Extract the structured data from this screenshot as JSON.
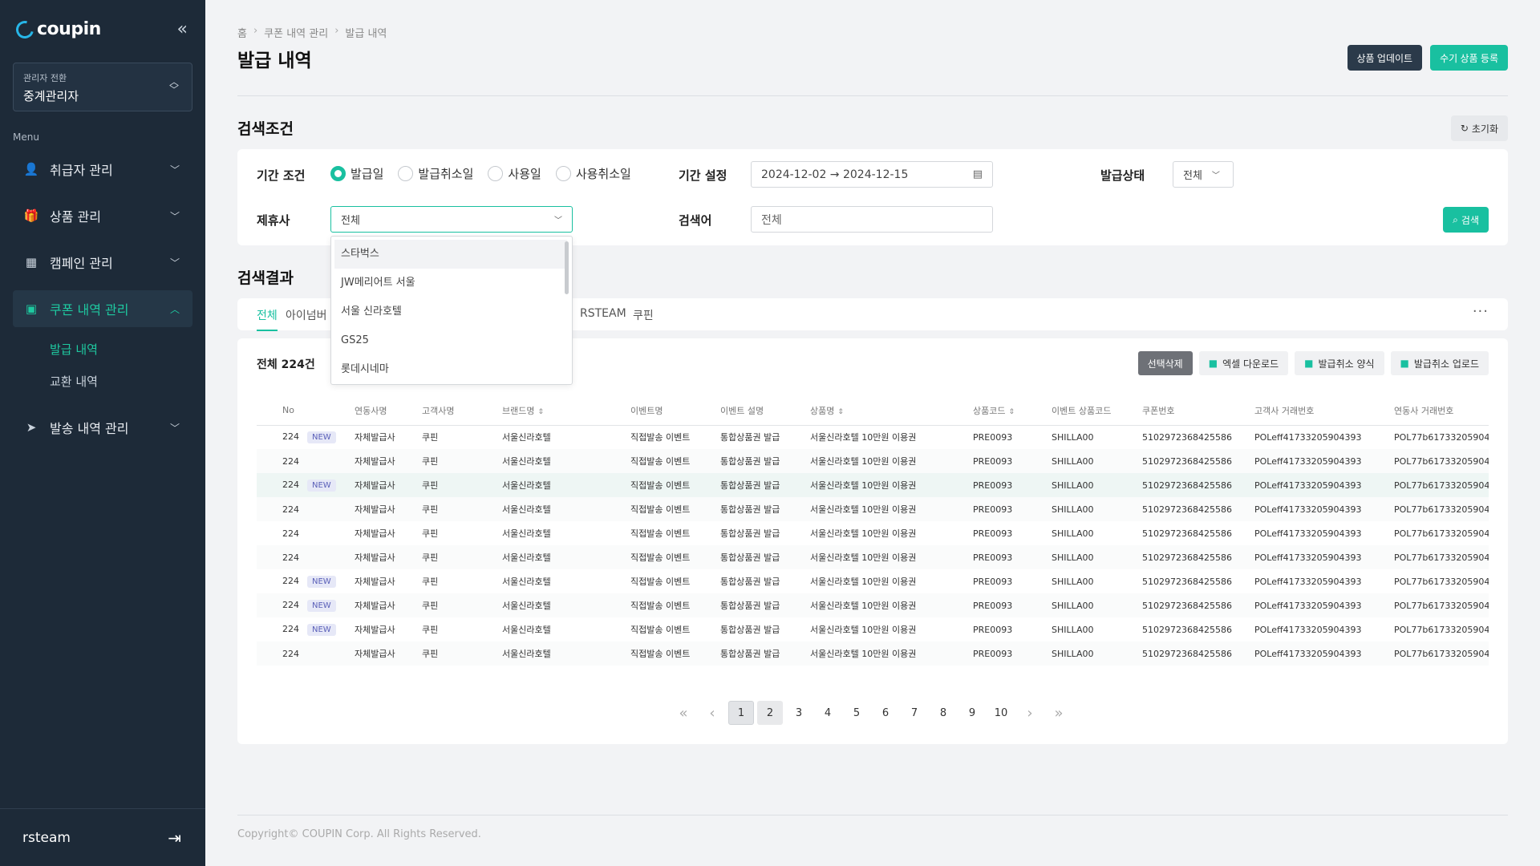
{
  "app": {
    "logo": "coupin",
    "collapse_icon": "«"
  },
  "sidebar": {
    "admin_switch_label": "관리자 전환",
    "admin_switch_value": "중계관리자",
    "menu_label": "Menu",
    "items": [
      {
        "label": "취급자 관리",
        "icon": "user-gear-icon"
      },
      {
        "label": "상품 관리",
        "icon": "gift-icon"
      },
      {
        "label": "캠페인 관리",
        "icon": "calendar-icon"
      },
      {
        "label": "쿠폰 내역 관리",
        "icon": "ticket-icon"
      },
      {
        "label": "발송 내역 관리",
        "icon": "send-icon"
      }
    ],
    "sub_items": [
      {
        "label": "발급 내역"
      },
      {
        "label": "교환 내역"
      }
    ],
    "footer_user": "rsteam"
  },
  "breadcrumb": [
    "홈",
    "쿠폰 내역 관리",
    "발급 내역"
  ],
  "page_title": "발급 내역",
  "top_buttons": {
    "update": "상품 업데이트",
    "manual": "수기 상품 등록"
  },
  "search": {
    "title": "검색조건",
    "reset": "초기화",
    "period_label": "기간 조건",
    "radios": [
      "발급일",
      "발급취소일",
      "사용일",
      "사용취소일"
    ],
    "period_setting_label": "기간 설정",
    "date_range": "2024-12-02 → 2024-12-15",
    "status_label": "발급상태",
    "status_value": "전체",
    "partner_label": "제휴사",
    "partner_value": "전체",
    "keyword_label": "검색어",
    "keyword_placeholder": "전체",
    "search_button": "검색"
  },
  "dropdown": [
    "스타벅스",
    "JW메리어트 서울",
    "서울 신라호텔",
    "GS25",
    "롯데시네마"
  ],
  "results": {
    "title": "검색결과",
    "tabs": [
      "전체",
      "아이넘버 인",
      "RSTEAM",
      "쿠핀"
    ],
    "total": "전체 224건",
    "actions": {
      "delete": "선택삭제",
      "excel": "엑셀 다운로드",
      "cancel_form": "발급취소 양식",
      "cancel_upload": "발급취소 업로드"
    },
    "columns": [
      "No",
      "연동사명",
      "고객사명",
      "브랜드명",
      "이벤트명",
      "이벤트 설명",
      "상품명",
      "상품코드",
      "이벤트 상품코드",
      "쿠폰번호",
      "고객사 거래번호",
      "연동사 거래번호"
    ],
    "new_label": "NEW",
    "rows": [
      {
        "no": "224",
        "new": true,
        "a": "자체발급사",
        "b": "쿠핀",
        "c": "서울신라호텔",
        "d": "직접발송 이벤트",
        "e": "통합상품권 발급",
        "f": "서울신라호텔 10만원 이용권",
        "g": "PRE0093",
        "h": "SHILLA00",
        "i": "5102972368425586",
        "j": "POLeff41733205904393",
        "k": "POL77b61733205904"
      },
      {
        "no": "224",
        "new": false,
        "a": "자체발급사",
        "b": "쿠핀",
        "c": "서울신라호텔",
        "d": "직접발송 이벤트",
        "e": "통합상품권 발급",
        "f": "서울신라호텔 10만원 이용권",
        "g": "PRE0093",
        "h": "SHILLA00",
        "i": "5102972368425586",
        "j": "POLeff41733205904393",
        "k": "POL77b61733205904"
      },
      {
        "no": "224",
        "new": true,
        "a": "자체발급사",
        "b": "쿠핀",
        "c": "서울신라호텔",
        "d": "직접발송 이벤트",
        "e": "통합상품권 발급",
        "f": "서울신라호텔 10만원 이용권",
        "g": "PRE0093",
        "h": "SHILLA00",
        "i": "5102972368425586",
        "j": "POLeff41733205904393",
        "k": "POL77b61733205904"
      },
      {
        "no": "224",
        "new": false,
        "a": "자체발급사",
        "b": "쿠핀",
        "c": "서울신라호텔",
        "d": "직접발송 이벤트",
        "e": "통합상품권 발급",
        "f": "서울신라호텔 10만원 이용권",
        "g": "PRE0093",
        "h": "SHILLA00",
        "i": "5102972368425586",
        "j": "POLeff41733205904393",
        "k": "POL77b61733205904"
      },
      {
        "no": "224",
        "new": false,
        "a": "자체발급사",
        "b": "쿠핀",
        "c": "서울신라호텔",
        "d": "직접발송 이벤트",
        "e": "통합상품권 발급",
        "f": "서울신라호텔 10만원 이용권",
        "g": "PRE0093",
        "h": "SHILLA00",
        "i": "5102972368425586",
        "j": "POLeff41733205904393",
        "k": "POL77b61733205904"
      },
      {
        "no": "224",
        "new": false,
        "a": "자체발급사",
        "b": "쿠핀",
        "c": "서울신라호텔",
        "d": "직접발송 이벤트",
        "e": "통합상품권 발급",
        "f": "서울신라호텔 10만원 이용권",
        "g": "PRE0093",
        "h": "SHILLA00",
        "i": "5102972368425586",
        "j": "POLeff41733205904393",
        "k": "POL77b61733205904"
      },
      {
        "no": "224",
        "new": true,
        "a": "자체발급사",
        "b": "쿠핀",
        "c": "서울신라호텔",
        "d": "직접발송 이벤트",
        "e": "통합상품권 발급",
        "f": "서울신라호텔 10만원 이용권",
        "g": "PRE0093",
        "h": "SHILLA00",
        "i": "5102972368425586",
        "j": "POLeff41733205904393",
        "k": "POL77b61733205904"
      },
      {
        "no": "224",
        "new": true,
        "a": "자체발급사",
        "b": "쿠핀",
        "c": "서울신라호텔",
        "d": "직접발송 이벤트",
        "e": "통합상품권 발급",
        "f": "서울신라호텔 10만원 이용권",
        "g": "PRE0093",
        "h": "SHILLA00",
        "i": "5102972368425586",
        "j": "POLeff41733205904393",
        "k": "POL77b61733205904"
      },
      {
        "no": "224",
        "new": true,
        "a": "자체발급사",
        "b": "쿠핀",
        "c": "서울신라호텔",
        "d": "직접발송 이벤트",
        "e": "통합상품권 발급",
        "f": "서울신라호텔 10만원 이용권",
        "g": "PRE0093",
        "h": "SHILLA00",
        "i": "5102972368425586",
        "j": "POLeff41733205904393",
        "k": "POL77b61733205904"
      },
      {
        "no": "224",
        "new": false,
        "a": "자체발급사",
        "b": "쿠핀",
        "c": "서울신라호텔",
        "d": "직접발송 이벤트",
        "e": "통합상품권 발급",
        "f": "서울신라호텔 10만원 이용권",
        "g": "PRE0093",
        "h": "SHILLA00",
        "i": "5102972368425586",
        "j": "POLeff41733205904393",
        "k": "POL77b61733205904"
      }
    ],
    "pages": [
      "1",
      "2",
      "3",
      "4",
      "5",
      "6",
      "7",
      "8",
      "9",
      "10"
    ],
    "current_page": "1"
  },
  "footer": {
    "copyright": "Copyright© COUPIN Corp. All Rights Reserved."
  },
  "colors": {
    "accent": "#19c0a0",
    "sidebar_bg": "#1d2a38",
    "dark_button": "#2b3a4a"
  }
}
